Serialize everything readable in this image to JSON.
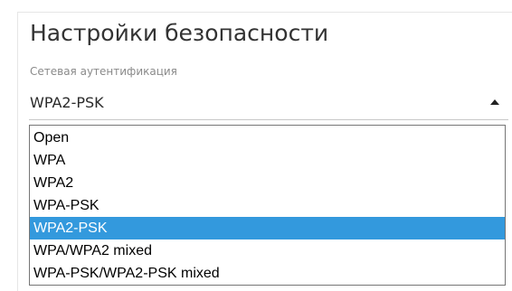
{
  "security": {
    "title": "Настройки безопасности",
    "auth_label": "Сетевая аутентификация",
    "auth_value": "WPA2-PSK",
    "options": [
      "Open",
      "WPA",
      "WPA2",
      "WPA-PSK",
      "WPA2-PSK",
      "WPA/WPA2 mixed",
      "WPA-PSK/WPA2-PSK mixed"
    ]
  },
  "icons": {
    "dropdown_caret": "caret-up-icon"
  },
  "colors": {
    "selected_option_bg": "#3399dd",
    "selected_option_text": "#ffffff"
  }
}
